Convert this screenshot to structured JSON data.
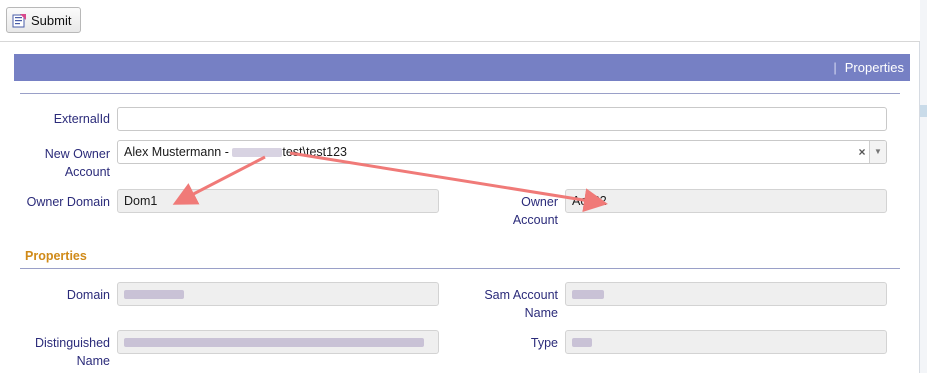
{
  "toolbar": {
    "submit_label": "Submit"
  },
  "section": {
    "title": "Properties"
  },
  "form": {
    "external_id": {
      "label": "ExternalId",
      "value": ""
    },
    "new_owner_account": {
      "label_line1": "New Owner",
      "label_line2": "Account",
      "value_prefix": "Alex Mustermann - ",
      "value_suffix": "test\\test123"
    },
    "owner_domain": {
      "label": "Owner Domain",
      "value": "Dom1"
    },
    "owner_account": {
      "label_line1": "Owner",
      "label_line2": "Account",
      "value": "Acc22"
    }
  },
  "properties": {
    "heading": "Properties",
    "domain": {
      "label": "Domain"
    },
    "sam_account_name": {
      "label_line1": "Sam Account",
      "label_line2": "Name"
    },
    "distinguished_name": {
      "label_line1": "Distinguished",
      "label_line2": "Name"
    },
    "type": {
      "label": "Type"
    }
  },
  "icons": {
    "submit": "save-form-icon",
    "clear": "clear-x-icon",
    "dropdown": "dropdown-arrow-icon"
  },
  "colors": {
    "section_bar": "#7680c4",
    "subheading": "#d08a18",
    "annotation_arrow": "#f07a78"
  }
}
